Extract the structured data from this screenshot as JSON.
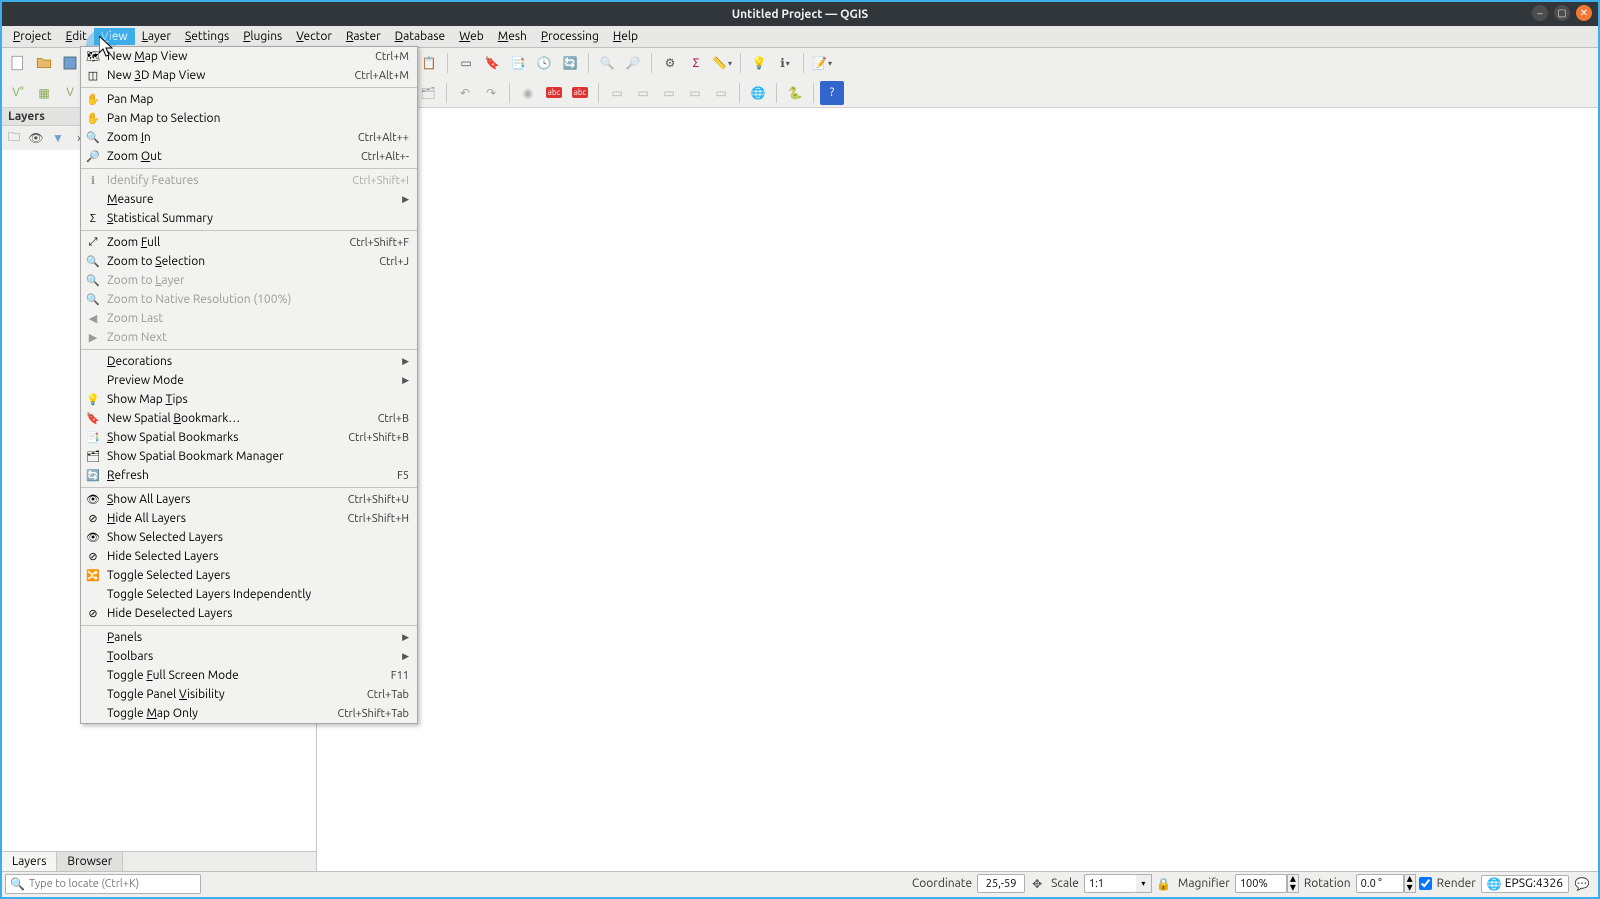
{
  "window": {
    "title": "Untitled Project — QGIS"
  },
  "menu": {
    "items": [
      "Project",
      "Edit",
      "View",
      "Layer",
      "Settings",
      "Plugins",
      "Vector",
      "Raster",
      "Database",
      "Web",
      "Mesh",
      "Processing",
      "Help"
    ],
    "underlines": [
      "P",
      "E",
      "V",
      "L",
      "S",
      "P",
      "V",
      "R",
      "D",
      "W",
      "M",
      "P",
      "H"
    ],
    "active_index": 2
  },
  "view_menu": [
    {
      "icon": "map",
      "label": "New Map View",
      "ul": "M",
      "short": "Ctrl+M"
    },
    {
      "icon": "cube",
      "label": "New 3D Map View",
      "ul": "3",
      "short": "Ctrl+Alt+M"
    },
    {
      "divider": true
    },
    {
      "icon": "hand",
      "label": "Pan Map"
    },
    {
      "icon": "hand-sel",
      "label": "Pan Map to Selection"
    },
    {
      "icon": "zoomin",
      "label": "Zoom In",
      "ul": "I",
      "short": "Ctrl+Alt++"
    },
    {
      "icon": "zoomout",
      "label": "Zoom Out",
      "ul": "O",
      "short": "Ctrl+Alt+-"
    },
    {
      "divider": true
    },
    {
      "icon": "identify",
      "label": "Identify Features",
      "short": "Ctrl+Shift+I",
      "disabled": true
    },
    {
      "icon": "",
      "label": "Measure",
      "ul": "M",
      "submenu": true
    },
    {
      "icon": "sigma",
      "label": "Statistical Summary",
      "ul": "S"
    },
    {
      "divider": true
    },
    {
      "icon": "zoomfull",
      "label": "Zoom Full",
      "ul": "F",
      "short": "Ctrl+Shift+F"
    },
    {
      "icon": "zoomsel",
      "label": "Zoom to Selection",
      "ul": "S",
      "short": "Ctrl+J"
    },
    {
      "icon": "zoomlayer",
      "label": "Zoom to Layer",
      "ul": "L",
      "disabled": true
    },
    {
      "icon": "zoomnat",
      "label": "Zoom to Native Resolution (100%)",
      "disabled": true
    },
    {
      "icon": "zoomlast",
      "label": "Zoom Last",
      "disabled": true
    },
    {
      "icon": "zoomnext",
      "label": "Zoom Next",
      "disabled": true
    },
    {
      "divider": true
    },
    {
      "icon": "",
      "label": "Decorations",
      "ul": "D",
      "submenu": true
    },
    {
      "icon": "",
      "label": "Preview Mode",
      "submenu": true
    },
    {
      "icon": "tip",
      "label": "Show Map Tips",
      "ul": "T"
    },
    {
      "icon": "bookmark",
      "label": "New Spatial Bookmark…",
      "ul": "B",
      "short": "Ctrl+B"
    },
    {
      "icon": "bookmarks",
      "label": "Show Spatial Bookmarks",
      "ul": "S",
      "short": "Ctrl+Shift+B"
    },
    {
      "icon": "bmk-mgr",
      "label": "Show Spatial Bookmark Manager"
    },
    {
      "icon": "refresh",
      "label": "Refresh",
      "ul": "R",
      "short": "F5"
    },
    {
      "divider": true
    },
    {
      "icon": "eye",
      "label": "Show All Layers",
      "ul": "S",
      "short": "Ctrl+Shift+U"
    },
    {
      "icon": "eye-off",
      "label": "Hide All Layers",
      "ul": "H",
      "short": "Ctrl+Shift+H"
    },
    {
      "icon": "eye-sel",
      "label": "Show Selected Layers"
    },
    {
      "icon": "eye-hide-sel",
      "label": "Hide Selected Layers"
    },
    {
      "icon": "toggle",
      "label": "Toggle Selected Layers"
    },
    {
      "icon": "",
      "label": "Toggle Selected Layers Independently"
    },
    {
      "icon": "eye-desel",
      "label": "Hide Deselected Layers"
    },
    {
      "divider": true
    },
    {
      "icon": "",
      "label": "Panels",
      "ul": "P",
      "submenu": true
    },
    {
      "icon": "",
      "label": "Toolbars",
      "ul": "T",
      "submenu": true
    },
    {
      "icon": "",
      "label": "Toggle Full Screen Mode",
      "ul": "F",
      "short": "F11"
    },
    {
      "icon": "",
      "label": "Toggle Panel Visibility",
      "ul": "V",
      "short": "Ctrl+Tab"
    },
    {
      "icon": "",
      "label": "Toggle Map Only",
      "ul": "M",
      "short": "Ctrl+Shift+Tab"
    }
  ],
  "panel": {
    "title": "Layers",
    "tabs": [
      "Layers",
      "Browser"
    ],
    "active_tab": 0
  },
  "locator": {
    "placeholder": "Type to locate (Ctrl+K)"
  },
  "status": {
    "coord_label": "Coordinate",
    "coord_value": "25,-59",
    "scale_label": "Scale",
    "scale_value": "1:1",
    "magnifier_label": "Magnifier",
    "magnifier_value": "100%",
    "rotation_label": "Rotation",
    "rotation_value": "0.0 °",
    "render_label": "Render",
    "render_checked": true,
    "crs": "EPSG:4326"
  }
}
